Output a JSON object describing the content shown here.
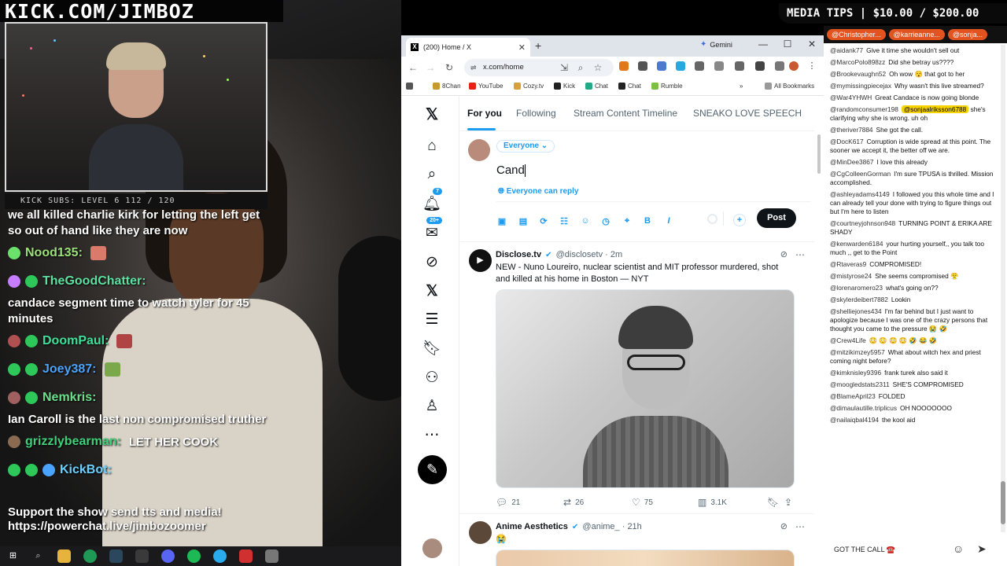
{
  "stream": {
    "banner_title": "KICK.COM/JIMBOZ",
    "kick_subs": "KICK SUBS: LEVEL 6 112 / 120",
    "media_tips": "MEDIA TIPS | $10.00 / $200.00",
    "overlay_chat": [
      {
        "type": "text",
        "text": "we all killed charlie kirk for letting the left get so out of hand like they are now"
      },
      {
        "type": "user",
        "name": "Nood135:",
        "color": "#9be07a",
        "message": ""
      },
      {
        "type": "user",
        "name": "TheGoodChatter:",
        "color": "#5ee0a0",
        "message": ""
      },
      {
        "type": "text",
        "text": "candace segment time to watch tyler for 45 minutes"
      },
      {
        "type": "user",
        "name": "DoomPaul:",
        "color": "#3fe09a",
        "message": ""
      },
      {
        "type": "user",
        "name": "Joey387:",
        "color": "#4aa3ff",
        "message": ""
      },
      {
        "type": "user",
        "name": "Nemkris:",
        "color": "#6ae08a",
        "message": ""
      },
      {
        "type": "text",
        "text": "Ian Caroll is the last non compromised truther"
      },
      {
        "type": "user",
        "name": "grizzlybearman:",
        "color": "#3fd07a",
        "message": "LET HER COOK"
      },
      {
        "type": "user",
        "name": "KickBot:",
        "color": "#6ad0ff",
        "message": ""
      }
    ],
    "support_text": "Support the show send tts and media! https://powerchat.live/jimbozoomer"
  },
  "browser": {
    "tab_title": "(200) Home / X",
    "gemini_label": "Gemini",
    "url": "x.com/home",
    "bookmarks": [
      "8Chan",
      "YouTube",
      "Cozy.tv",
      "Kick",
      "Chat",
      "Chat",
      "Rumble"
    ],
    "all_bookmarks": "All Bookmarks"
  },
  "x": {
    "tabs": [
      "For you",
      "Following",
      "Stream Content Timeline",
      "SNEAKO LOVE SPEECH"
    ],
    "nav": {
      "notif_count": "7",
      "messages_count": "20+"
    },
    "composer": {
      "audience": "Everyone ⌄",
      "text": "Cand",
      "reply_setting": "Everyone can reply",
      "post_label": "Post"
    },
    "tweets": [
      {
        "name": "Disclose.tv",
        "handle": "@disclosetv · 2m",
        "text": "NEW - Nuno Loureiro, nuclear scientist and MIT professor murdered, shot and killed at his home in Boston — NYT",
        "replies": "21",
        "reposts": "26",
        "likes": "75",
        "views": "3.1K"
      },
      {
        "name": "Anime Aesthetics",
        "handle": "@anime_ · 21h",
        "text": "😭"
      }
    ]
  },
  "chat": {
    "pinned": [
      "@Christopher...",
      "@karrieanne...",
      "@sonja..."
    ],
    "messages": [
      {
        "user": "@aidank77",
        "text": "Give it time she wouldn't sell out"
      },
      {
        "user": "@MarcoPolo898zz",
        "text": "Did she betray us????"
      },
      {
        "user": "@Brookevaughn52",
        "text": "Oh wow 😯 that got to her"
      },
      {
        "user": "@mymissingpiecejax",
        "text": "Why wasn't this live streamed?"
      },
      {
        "user": "@War4YHWH",
        "text": "Great Candace is now going blonde"
      },
      {
        "user": "@randomconsumer198",
        "mention": "@sonjaalriksson6788",
        "text": "she's clarifying why she is wrong. uh oh"
      },
      {
        "user": "@theriver7884",
        "text": "She got the call."
      },
      {
        "user": "@DocK617",
        "text": "Corruption is wide spread at this point. The sooner we accept it, the better off we are."
      },
      {
        "user": "@MinDee3867",
        "text": "I love this already"
      },
      {
        "user": "@CgColleenGorman",
        "text": "I'm sure TPUSA is thrilled. Mission accomplished."
      },
      {
        "user": "@ashleyadams4149",
        "text": "I followed you this whole time and I can already tell your done with trying to figure things out but I'm here to listen"
      },
      {
        "user": "@courtneyjohnson948",
        "text": "TURNING POINT & ERIKA ARE SHADY"
      },
      {
        "user": "@kenwarden6184",
        "text": "your hurting yourself,, you talk too much ,, get to the Point"
      },
      {
        "user": "@Rtaveras9",
        "text": "COMPROMISED!"
      },
      {
        "user": "@mistyrose24",
        "text": "She seems compromised 😤"
      },
      {
        "user": "@lorenaromero23",
        "text": "what's going on??"
      },
      {
        "user": "@skylerdeibert7882",
        "text": "Lookin"
      },
      {
        "user": "@shelliejones434",
        "text": "I'm far behind but I just want to apologize because I was one of the crazy persons that thought you came to the pressure 😭 🤣"
      },
      {
        "user": "@Crew4Life",
        "text": "😳 😳 😳 😳 🤣 😂 🤣"
      },
      {
        "user": "@mitzikimzey5957",
        "text": "What about witch hex and priest coming night before?"
      },
      {
        "user": "@kimknisley9396",
        "text": "frank turek also said it"
      },
      {
        "user": "@moogledstats2311",
        "text": "SHE'S COMPROMISED"
      },
      {
        "user": "@BlameApril23",
        "text": "FOLDED"
      },
      {
        "user": "@dimaulautille.triplicus",
        "text": "OH NOOOOOOO"
      },
      {
        "user": "@nailaiqbal4194",
        "text": "the kool aid"
      }
    ],
    "input_value": "GOT THE CALL ☎️"
  }
}
